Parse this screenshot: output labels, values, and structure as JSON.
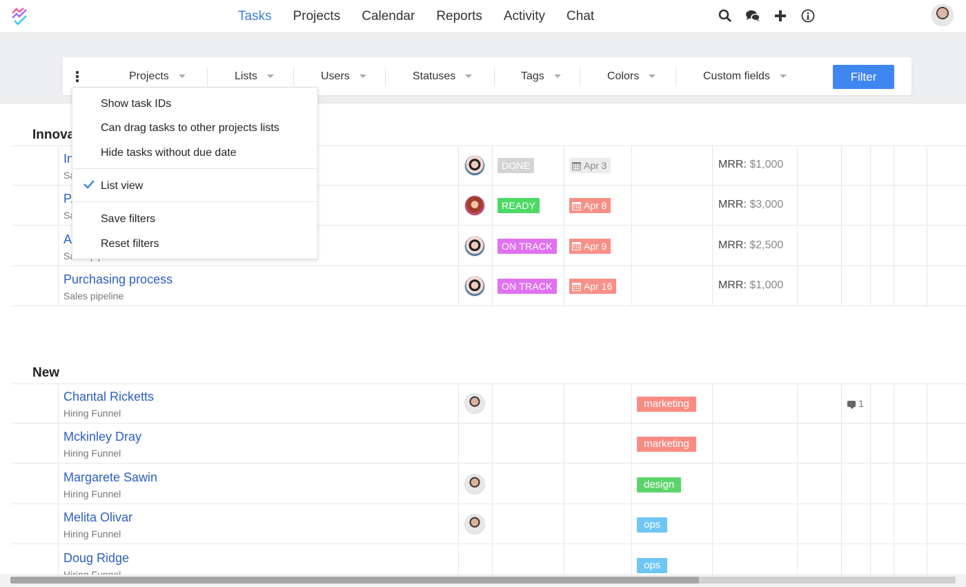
{
  "nav": {
    "items": [
      {
        "label": "Tasks",
        "active": true
      },
      {
        "label": "Projects",
        "active": false
      },
      {
        "label": "Calendar",
        "active": false
      },
      {
        "label": "Reports",
        "active": false
      },
      {
        "label": "Activity",
        "active": false
      },
      {
        "label": "Chat",
        "active": false
      }
    ],
    "icons": [
      "search-icon",
      "chat-bubbles-icon",
      "plus-icon",
      "info-icon"
    ],
    "accent_color": "#3b7fd4"
  },
  "filters": {
    "dropdowns": [
      "Projects",
      "Lists",
      "Users",
      "Statuses",
      "Tags",
      "Colors",
      "Custom fields"
    ],
    "filter_button": "Filter",
    "filter_button_color": "#3f86f0"
  },
  "menu": {
    "items": [
      {
        "label": "Show task IDs",
        "checked": false
      },
      {
        "label": "Can drag tasks to other projects lists",
        "checked": false
      },
      {
        "label": "Hide tasks without due date",
        "checked": false
      },
      {
        "label": "List view",
        "checked": true
      },
      {
        "label": "Save filters",
        "checked": false
      },
      {
        "label": "Reset filters",
        "checked": false
      }
    ]
  },
  "sections": [
    {
      "title": "Innovation",
      "tasks": [
        {
          "title": "In...",
          "subtitle": "Sales pipeline",
          "avatar": "female-1",
          "status": "DONE",
          "status_color": "#d4d4d4",
          "date": "Apr 3",
          "date_overdue": false,
          "mrr_label": "MRR:",
          "mrr_value": "$1,000"
        },
        {
          "title": "P...",
          "subtitle": "Sales pipeline",
          "avatar": "female-2",
          "status": "READY",
          "status_color": "#4cd964",
          "date": "Apr 8",
          "date_overdue": true,
          "mrr_label": "MRR:",
          "mrr_value": "$3,000"
        },
        {
          "title": "A...",
          "subtitle": "Sales pipeline",
          "avatar": "female-1",
          "status": "ON TRACK",
          "status_color": "#e072f0",
          "date": "Apr 9",
          "date_overdue": true,
          "mrr_label": "MRR:",
          "mrr_value": "$2,500"
        },
        {
          "title": "Purchasing process",
          "subtitle": "Sales pipeline",
          "avatar": "female-1",
          "status": "ON TRACK",
          "status_color": "#e072f0",
          "date": "Apr 16",
          "date_overdue": true,
          "mrr_label": "MRR:",
          "mrr_value": "$1,000"
        }
      ]
    },
    {
      "title": "New",
      "tasks": [
        {
          "title": "Chantal Ricketts",
          "subtitle": "Hiring Funnel",
          "avatar": "male-1",
          "tag": "marketing",
          "tag_color": "#fa8b83",
          "comments": "1"
        },
        {
          "title": "Mckinley Dray",
          "subtitle": "Hiring Funnel",
          "avatar": null,
          "tag": "marketing",
          "tag_color": "#fa8b83"
        },
        {
          "title": "Margarete Sawin",
          "subtitle": "Hiring Funnel",
          "avatar": "male-1",
          "tag": "design",
          "tag_color": "#5dd46b"
        },
        {
          "title": "Melita Olivar",
          "subtitle": "Hiring Funnel",
          "avatar": "male-1",
          "tag": "ops",
          "tag_color": "#6ec6f5"
        },
        {
          "title": "Doug Ridge",
          "subtitle": "Hiring Funnel",
          "avatar": null,
          "tag": "ops",
          "tag_color": "#6ec6f5"
        }
      ]
    }
  ],
  "colors": {
    "overdue_date_bg": "#f98f86",
    "normal_date_bg": "#ececec",
    "link_color": "#2a5fc1"
  }
}
